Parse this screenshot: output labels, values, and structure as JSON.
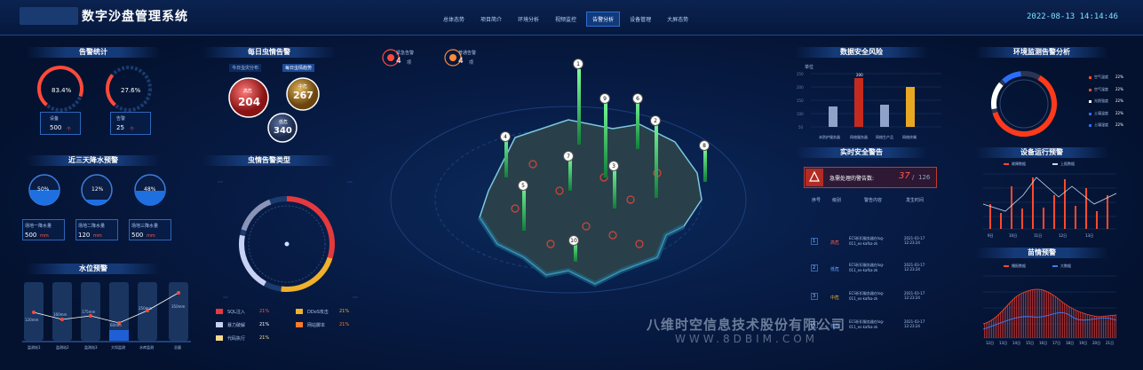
{
  "header": {
    "title": "数字沙盘管理系统",
    "tabs": [
      "总体态势",
      "项目简介",
      "环境分析",
      "视频监控",
      "告警分析",
      "设备管理",
      "大屏态势"
    ],
    "active_tab": 4,
    "datetime": "2022-08-13 14:14:46"
  },
  "alarm_stats": {
    "title": "告警统计",
    "gauges": [
      {
        "value": "83.4%"
      },
      {
        "value": "27.6%"
      }
    ],
    "cards": [
      {
        "label": "设备",
        "value": "500",
        "unit": "个"
      },
      {
        "label": "告警",
        "value": "25",
        "unit": "个"
      }
    ]
  },
  "pest_daily": {
    "title": "每日虫情告警",
    "tabs": [
      "今日虫灾分布",
      "每日虫情趋势"
    ],
    "levels": [
      {
        "label": "高危",
        "value": "204"
      },
      {
        "label": "中危",
        "value": "267"
      },
      {
        "label": "低危",
        "value": "340"
      }
    ]
  },
  "rain_warning": {
    "title": "近三天降水预警",
    "gauges": [
      "50%",
      "12%",
      "48%"
    ],
    "cards": [
      {
        "label": "场地一降水量",
        "value": "500",
        "unit": "mm"
      },
      {
        "label": "场地二降水量",
        "value": "120",
        "unit": "mm"
      },
      {
        "label": "场地三降水量",
        "value": "500",
        "unit": "mm"
      }
    ]
  },
  "water_level": {
    "title": "水位预警",
    "values": [
      "120mm",
      "160mm",
      "175mm",
      "60mm",
      "250mm",
      "350mm"
    ],
    "labels": [
      "监测站1",
      "监测站2",
      "监测站3",
      "大坝监测",
      "水库监测",
      "总量"
    ]
  },
  "pest_types": {
    "title": "虫情告警类型",
    "legend": [
      {
        "name": "SQL注入",
        "pct": "21%",
        "color": "#e5393d"
      },
      {
        "name": "DDoS攻击",
        "pct": "21%",
        "color": "#f0b02a"
      },
      {
        "name": "暴力破解",
        "pct": "21%",
        "color": "#c7d2f5"
      },
      {
        "name": "网站脚本",
        "pct": "21%",
        "color": "#ff7a2d"
      },
      {
        "name": "代码执行",
        "pct": "21%",
        "color": "#f6d98f"
      }
    ]
  },
  "map_alarms": {
    "urgent": {
      "label": "紧急告警",
      "value": "4",
      "unit": "项"
    },
    "normal": {
      "label": "普通告警",
      "value": "4",
      "unit": "项"
    },
    "pins": [
      "1",
      "2",
      "3",
      "4",
      "5",
      "6",
      "7",
      "8",
      "9",
      "10"
    ]
  },
  "data_risk": {
    "title": "数据安全风险",
    "unit": "单位",
    "highlight": "200",
    "categories": [
      "未防护服务器",
      "网络服务器",
      "网络生产品",
      "网络终端"
    ]
  },
  "realtime_alarm": {
    "title": "实时安全警告",
    "pending_label": "急需处理的警告数:",
    "pending": "37",
    "total": "126",
    "columns": [
      "序号",
      "级别",
      "警告内容",
      "发生时间"
    ],
    "rows": [
      {
        "no": "1",
        "level": "高危",
        "content": "ECS折扣服务器在log-011_es-kafka-zk",
        "time": "2021-03-17 12:23:24"
      },
      {
        "no": "2",
        "level": "低危",
        "content": "ECS折扣服务器在log-011_es-kafka-zk",
        "time": "2021-03-17 12:23:24"
      },
      {
        "no": "3",
        "level": "中危",
        "content": "ECS折扣服务器在log-011_es-kafka-zk",
        "time": "2021-03-17 12:23:24"
      },
      {
        "no": "4",
        "level": "低危",
        "content": "ECS折扣服务器在log-011_es-kafka-zk",
        "time": "2021-03-17 12:23:24"
      }
    ]
  },
  "env_monitor": {
    "title": "环境监测告警分析",
    "legend": [
      {
        "name": "空气温度",
        "pct": "22%",
        "color": "#ff4a2a"
      },
      {
        "name": "空气湿度",
        "pct": "22%",
        "color": "#ff4a2a"
      },
      {
        "name": "光照强度",
        "pct": "22%",
        "color": "#ffffff"
      },
      {
        "name": "土壤温度",
        "pct": "22%",
        "color": "#2a6dff"
      },
      {
        "name": "土壤湿度",
        "pct": "22%",
        "color": "#2a6dff"
      }
    ]
  },
  "device_warning": {
    "title": "设备运行预警",
    "legend": [
      "故障数据",
      "上报数据"
    ],
    "categories": [
      "9日",
      "10日",
      "11日",
      "12日",
      "13日"
    ]
  },
  "seedling_warning": {
    "title": "苗情预警",
    "legend": [
      "播报数据",
      "大数据"
    ],
    "categories": [
      "12日",
      "13日",
      "14日",
      "15日",
      "16日",
      "17日",
      "18日",
      "19日",
      "20日",
      "21日"
    ]
  },
  "watermark": {
    "company": "八维时空信息技术股份有限公司",
    "url": "WWW.8DBIM.COM"
  }
}
